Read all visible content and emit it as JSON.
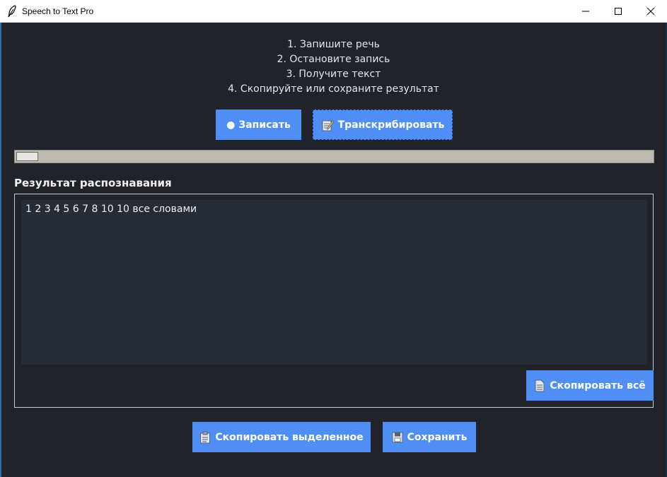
{
  "window": {
    "title": "Speech to Text Pro",
    "minimize_icon": "minimize-icon",
    "maximize_icon": "maximize-icon",
    "close_icon": "close-icon"
  },
  "instructions": [
    "1. Запишите речь",
    "2. Остановите запись",
    "3. Получите текст",
    "4. Скопируйте или сохраните результат"
  ],
  "buttons": {
    "record": "● Записать",
    "transcribe": "Транскрибировать",
    "copy_all": "Скопировать всё",
    "copy_selected": "Скопировать выделенное",
    "save": "Сохранить"
  },
  "icons": {
    "transcribe": "memo-icon",
    "copy_all": "document-icon",
    "copy_selected": "clipboard-icon",
    "save": "floppy-disk-icon"
  },
  "progress": {
    "fraction": 0.035
  },
  "result": {
    "label": "Результат распознавания",
    "text": "1 2 3 4 5 6 7 8 10 10 все словами"
  },
  "colors": {
    "background": "#202329",
    "accent_button": "#4f8ff5",
    "text_area": "#272b33"
  }
}
